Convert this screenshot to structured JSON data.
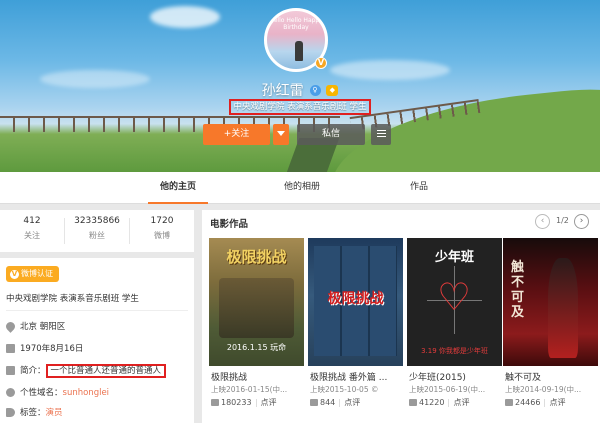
{
  "profile": {
    "name": "孙红雷",
    "avatar_caption": "Hello Hello Happy Birthday",
    "bio": "中央戏剧学院 表演系音乐剧班 学生",
    "follow_label": "+关注",
    "message_label": "私信"
  },
  "tabs": [
    {
      "label": "他的主页",
      "active": true
    },
    {
      "label": "他的相册",
      "active": false
    },
    {
      "label": "作品",
      "active": false
    }
  ],
  "stats": [
    {
      "value": "412",
      "label": "关注"
    },
    {
      "value": "32335866",
      "label": "粉丝"
    },
    {
      "value": "1720",
      "label": "微博"
    }
  ],
  "info": {
    "cert_badge": "微博认证",
    "cert_text": "中央戏剧学院 表演系音乐剧班 学生",
    "location": "北京 朝阳区",
    "birthday": "1970年8月16日",
    "intro_label": "简介：",
    "intro_value": "一个比普通人还普通的普通人",
    "domain_label": "个性域名：",
    "domain_value": "sunhonglei",
    "tag_label": "标签：",
    "tag_value": "演员"
  },
  "movies": {
    "title": "电影作品",
    "pager": "1/2",
    "items": [
      {
        "title": "极限挑战",
        "date": "上映2016-01-15(中...",
        "likes": "180233",
        "review": "点评",
        "poster_text": "极限挑战",
        "poster_sub": "2016.1.15 玩命",
        "color": "#e8c34a"
      },
      {
        "title": "极限挑战 番外篇 ...",
        "date": "上映2015-10-05 ©",
        "likes": "844",
        "review": "点评",
        "poster_text": "极限挑战",
        "poster_sub": "",
        "color": "#c81e1e"
      },
      {
        "title": "少年班(2015)",
        "date": "上映2015-06-19(中...",
        "likes": "41220",
        "review": "点评",
        "poster_text": "少年班",
        "poster_sub": "3.19 你我都是少年班",
        "color": "#e23b3b"
      },
      {
        "title": "触不可及",
        "date": "上映2014-09-19(中...",
        "likes": "24466",
        "review": "点评",
        "poster_text": "触不可及",
        "poster_sub": "",
        "color": "#f2e6d6"
      }
    ]
  }
}
